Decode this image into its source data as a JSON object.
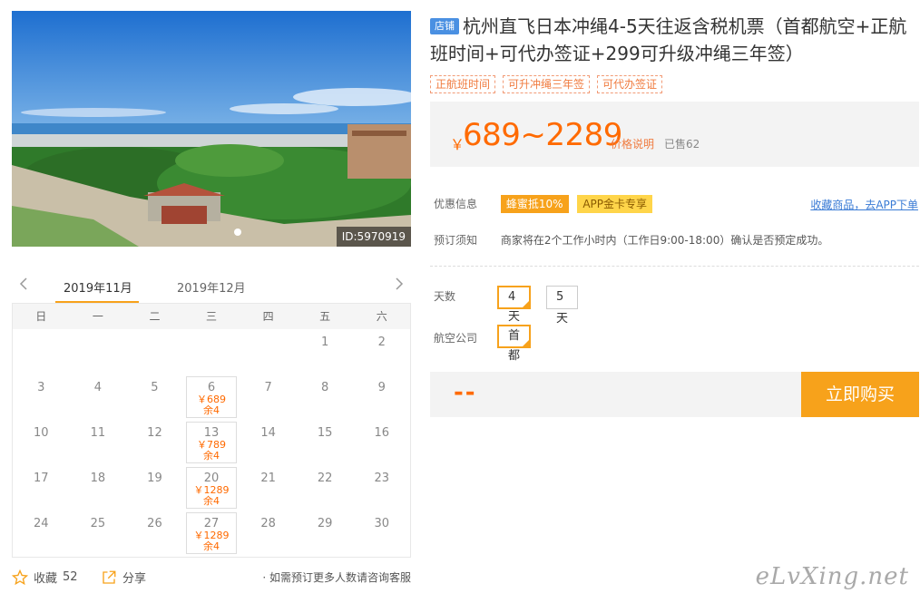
{
  "photo": {
    "id_label": "ID:5970919"
  },
  "calendar": {
    "tabs": [
      "2019年11月",
      "2019年12月"
    ],
    "weekdays": [
      "日",
      "一",
      "二",
      "三",
      "四",
      "五",
      "六"
    ],
    "weeks": [
      [
        {
          "d": ""
        },
        {
          "d": ""
        },
        {
          "d": ""
        },
        {
          "d": ""
        },
        {
          "d": ""
        },
        {
          "d": "1"
        },
        {
          "d": "2"
        }
      ],
      [
        {
          "d": "3"
        },
        {
          "d": "4"
        },
        {
          "d": "5"
        },
        {
          "d": "6",
          "price": "￥689",
          "stock": "余4"
        },
        {
          "d": "7"
        },
        {
          "d": "8"
        },
        {
          "d": "9"
        }
      ],
      [
        {
          "d": "10"
        },
        {
          "d": "11"
        },
        {
          "d": "12"
        },
        {
          "d": "13",
          "price": "￥789",
          "stock": "余4"
        },
        {
          "d": "14"
        },
        {
          "d": "15"
        },
        {
          "d": "16"
        }
      ],
      [
        {
          "d": "17"
        },
        {
          "d": "18"
        },
        {
          "d": "19"
        },
        {
          "d": "20",
          "price": "￥1289",
          "stock": "余4"
        },
        {
          "d": "21"
        },
        {
          "d": "22"
        },
        {
          "d": "23"
        }
      ],
      [
        {
          "d": "24"
        },
        {
          "d": "25"
        },
        {
          "d": "26"
        },
        {
          "d": "27",
          "price": "￥1289",
          "stock": "余4"
        },
        {
          "d": "28"
        },
        {
          "d": "29"
        },
        {
          "d": "30"
        }
      ]
    ]
  },
  "footer": {
    "fav_label": "收藏",
    "fav_count": "52",
    "share_label": "分享",
    "note": "· 如需预订更多人数请咨询客服"
  },
  "product": {
    "shop_tag": "店铺",
    "title": "杭州直飞日本冲绳4-5天往返含税机票（首都航空+正航班时间+可代办签证+299可升级冲绳三年签）",
    "tags": [
      "正航班时间",
      "可升冲绳三年签",
      "可代办签证"
    ],
    "price_symbol": "￥",
    "price_range": "689~2289",
    "price_explain": "价格说明",
    "sold": "已售62",
    "promo_label": "优惠信息",
    "promo_badges": [
      "蜂蜜抵10%",
      "APP金卡专享"
    ],
    "fav_app_link": "收藏商品，去APP下单",
    "notice_label": "预订须知",
    "notice_text": "商家将在2个工作小时内（工作日9:00-18:00）确认是否预定成功。",
    "days_label": "天数",
    "days_options": [
      "4天",
      "5天"
    ],
    "airline_label": "航空公司",
    "airline_options": [
      "首都"
    ],
    "total": "--",
    "buy_label": "立即购买"
  },
  "watermark": "eLvXing.net",
  "colors": {
    "accent": "#f7a21b",
    "price": "#ff6a00",
    "link": "#3a7bd5"
  }
}
